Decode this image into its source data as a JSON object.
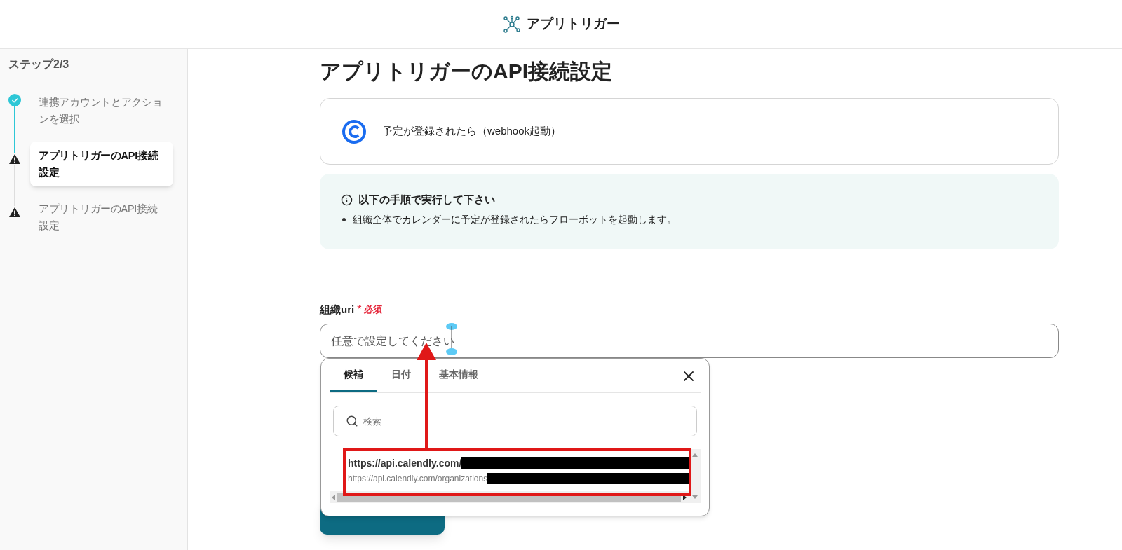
{
  "header": {
    "title": "アプリトリガー"
  },
  "sidebar": {
    "step_label": "ステップ2/3",
    "steps": [
      {
        "label": "連携アカウントとアクションを選択",
        "kind": "done",
        "selected": false
      },
      {
        "label": "アプリトリガーのAPI接続設定",
        "kind": "warning",
        "selected": true
      },
      {
        "label": "アプリトリガーのAPI接続設定",
        "kind": "warning",
        "selected": false
      }
    ]
  },
  "main": {
    "title": "アプリトリガーのAPI接続設定",
    "trigger_card": {
      "label": "予定が登録されたら（webhook起動）"
    },
    "info": {
      "heading": "以下の手順で実行して下さい",
      "items": [
        "組織全体でカレンダーに予定が登録されたらフローボットを起動します。"
      ]
    },
    "field": {
      "label": "組織uri",
      "required_mark": "*",
      "required_text": "必須",
      "placeholder": "任意で設定してください"
    }
  },
  "popup": {
    "tabs": [
      {
        "label": "候補",
        "selected": true
      },
      {
        "label": "日付",
        "selected": false
      },
      {
        "label": "基本情報",
        "selected": false
      }
    ],
    "search": {
      "placeholder": "検索"
    },
    "options": [
      {
        "title": "https://api.calendly.com/",
        "subtitle": "https://api.calendly.com/organizations"
      }
    ]
  }
}
